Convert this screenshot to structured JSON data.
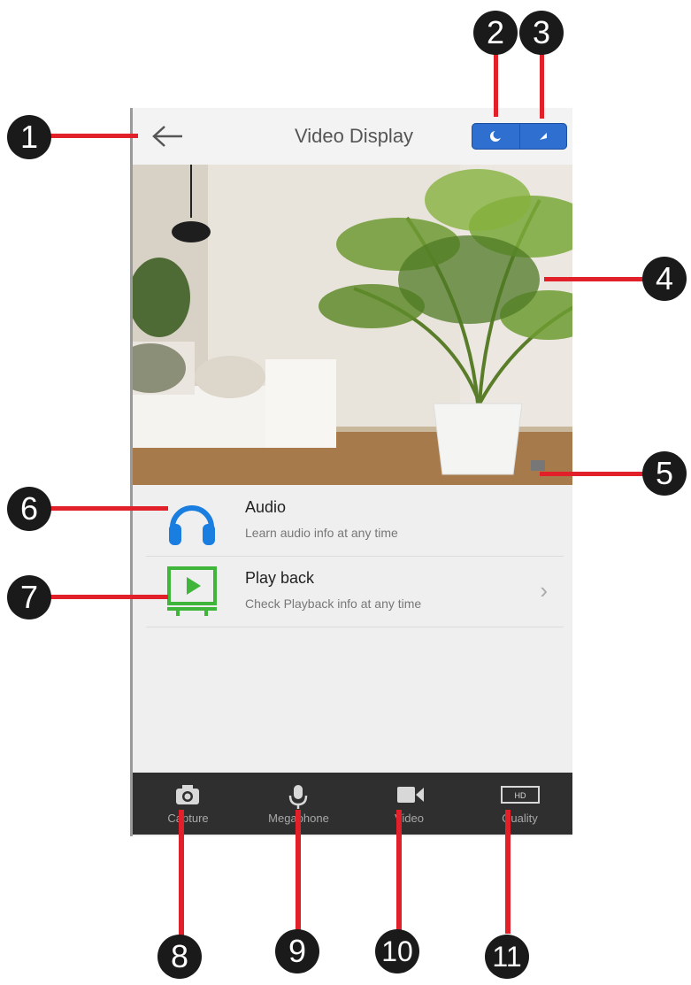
{
  "header": {
    "title": "Video Display"
  },
  "menu": {
    "items": [
      {
        "title": "Audio",
        "subtitle": "Learn audio info at any time"
      },
      {
        "title": "Play back",
        "subtitle": "Check Playback info at any time"
      }
    ]
  },
  "toolbar": {
    "buttons": [
      {
        "label": "Capture",
        "icon": "camera-icon"
      },
      {
        "label": "Megaphone",
        "icon": "microphone-icon"
      },
      {
        "label": "Video",
        "icon": "video-camera-icon"
      },
      {
        "label": "Quality",
        "icon": "hd-icon",
        "badge": "HD"
      }
    ]
  },
  "callouts": [
    "1",
    "2",
    "3",
    "4",
    "5",
    "6",
    "7",
    "8",
    "9",
    "10",
    "11"
  ],
  "colors": {
    "accent": "#2f6fd0",
    "audio_icon": "#1a7de0",
    "playback_icon": "#3fb53a",
    "callout_line": "#e1202a"
  }
}
